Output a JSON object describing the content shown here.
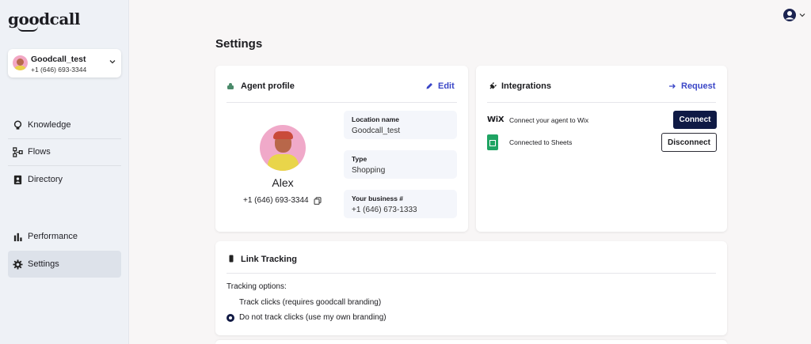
{
  "brand": {
    "logo_text": "goodcall"
  },
  "account": {
    "name": "Goodcall_test",
    "phone": "+1 (646) 693-3344"
  },
  "sidebar": {
    "items": [
      {
        "label": "Knowledge",
        "icon": "lightbulb-icon"
      },
      {
        "label": "Flows",
        "icon": "flows-icon"
      },
      {
        "label": "Directory",
        "icon": "directory-icon"
      },
      {
        "label": "Performance",
        "icon": "bar-chart-icon"
      },
      {
        "label": "Settings",
        "icon": "gear-icon",
        "active": true
      }
    ]
  },
  "page": {
    "title": "Settings"
  },
  "agent_profile": {
    "title": "Agent profile",
    "edit_label": "Edit",
    "name": "Alex",
    "phone": "+1 (646) 693-3344",
    "fields": [
      {
        "label": "Location name",
        "value": "Goodcall_test"
      },
      {
        "label": "Type",
        "value": "Shopping"
      },
      {
        "label": "Your business #",
        "value": "+1 (646) 673-1333"
      }
    ]
  },
  "integrations": {
    "title": "Integrations",
    "request_label": "Request",
    "items": [
      {
        "logo": "WiX",
        "text": "Connect your agent to Wix",
        "button": "Connect"
      },
      {
        "logo": "sheets-icon",
        "text": "Connected to Sheets",
        "button": "Disconnect"
      }
    ]
  },
  "link_tracking": {
    "title": "Link Tracking",
    "options_label": "Tracking options:",
    "options": [
      {
        "label": "Track clicks (requires goodcall branding)",
        "selected": false
      },
      {
        "label": "Do not track clicks (use my own branding)",
        "selected": true
      }
    ]
  },
  "colors": {
    "accent": "#3a46c7",
    "primary_button": "#0f1a45",
    "sidebar_bg": "#eef1f6",
    "page_bg": "#f8f6f6"
  }
}
